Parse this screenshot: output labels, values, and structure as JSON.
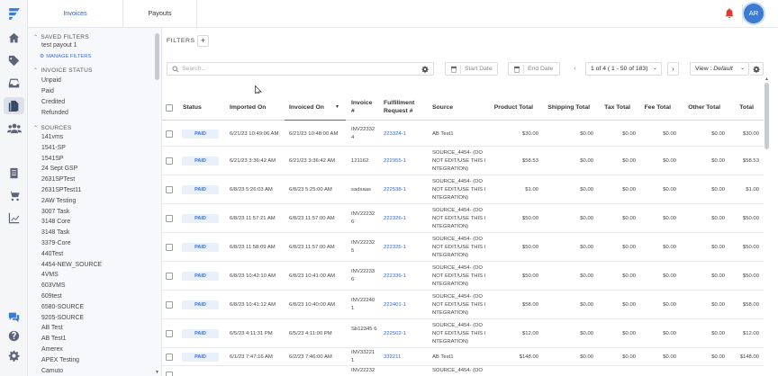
{
  "topbar": {
    "tabs": [
      {
        "label": "Invoices"
      },
      {
        "label": "Payouts"
      }
    ],
    "avatar_initials": "AR"
  },
  "rail": {
    "icons": [
      "logo-icon",
      "home-icon",
      "tag-icon",
      "inbox-icon",
      "invoices-icon",
      "users-icon",
      "report-icon",
      "cart-icon",
      "chart-icon",
      "chat-icon",
      "help-icon",
      "settings-icon"
    ]
  },
  "sidebar": {
    "saved_filters": {
      "heading": "SAVED FILTERS",
      "items": [
        "test payout 1"
      ],
      "manage_link": "MANAGE FILTERS"
    },
    "invoice_status": {
      "heading": "INVOICE STATUS",
      "items": [
        "Unpaid",
        "Paid",
        "Credited",
        "Refunded"
      ]
    },
    "sources": {
      "heading": "SOURCES",
      "items": [
        "141vms",
        "1541-SP",
        "1541SP",
        "24 Sept GSP",
        "2631SPTest",
        "2631SPTest11",
        "2AW Testing",
        "3007 Task",
        "3148 Core",
        "3148 Task",
        "3379-Core",
        "440Test",
        "4454-NEW_SOURCE",
        "4VMS",
        "603VMS",
        "609test",
        "6580-SOURCE",
        "9205-SOURCE",
        "AB Test",
        "AB Test1",
        "Amerex",
        "APEX Testing",
        "Camuto"
      ]
    }
  },
  "toolbar": {
    "filters_label": "FILTERS",
    "add_filter": "+",
    "search_placeholder": "Search...",
    "start_date": "Start Date",
    "end_date": "End Date",
    "prev": "‹",
    "next": "›",
    "page_info": "1 of 4 ( 1 - 50 of 183)",
    "view_label": "View :",
    "view_value": "Default"
  },
  "table": {
    "columns": {
      "status": "Status",
      "imported": "Imported On",
      "invoiced": "Invoiced On",
      "invoice_l1": "Invoice",
      "invoice_l2": "#",
      "fulfill_l1": "Fulfillment",
      "fulfill_l2": "Request #",
      "source": "Source",
      "product": "Product Total",
      "shipping": "Shipping Total",
      "tax": "Tax Total",
      "fee": "Fee Total",
      "other": "Other Total",
      "total": "Total"
    },
    "rows": [
      {
        "status": "PAID",
        "imported": "6/21/23 10:49:06 AM",
        "invoiced": "6/21/23 10:48:00 AM",
        "invoice": "INV22332 4",
        "fulfill": "223324-1",
        "source": "AB Test1",
        "product": "$30.00",
        "shipping": "$0.00",
        "tax": "$0.00",
        "fee": "$0.00",
        "other": "$0.00",
        "total": "$30.00"
      },
      {
        "status": "PAID",
        "imported": "6/21/23 3:36:42 AM",
        "invoiced": "6/21/23 3:36:42 AM",
        "invoice": "121162",
        "fulfill": "222955-1",
        "source": "SOURCE_4454- (DO NOT EDIT/USE THIS I NTEGRATION)",
        "product": "$58.53",
        "shipping": "$0.00",
        "tax": "$0.00",
        "fee": "$0.00",
        "other": "$0.00",
        "total": "$58.53"
      },
      {
        "status": "PAID",
        "imported": "6/8/23 5:26:03 AM",
        "invoiced": "6/8/23 5:25:00 AM",
        "invoice": "sadsaas",
        "fulfill": "222538-1",
        "source": "SOURCE_4454- (DO NOT EDIT/USE THIS I NTEGRATION)",
        "product": "$1.00",
        "shipping": "$0.00",
        "tax": "$0.00",
        "fee": "$0.00",
        "other": "$0.00",
        "total": "$1.00"
      },
      {
        "status": "PAID",
        "imported": "6/8/23 11:57:21 AM",
        "invoiced": "6/8/23 11:57:00 AM",
        "invoice": "INV22232 6",
        "fulfill": "222326-1",
        "source": "SOURCE_4454- (DO NOT EDIT/USE THIS I NTEGRATION)",
        "product": "$50.00",
        "shipping": "$0.00",
        "tax": "$0.00",
        "fee": "$0.00",
        "other": "$0.00",
        "total": "$50.00"
      },
      {
        "status": "PAID",
        "imported": "6/8/23 11:58:09 AM",
        "invoiced": "6/8/23 11:57:00 AM",
        "invoice": "INV22232 5",
        "fulfill": "222325-1",
        "source": "SOURCE_4454- (DO NOT EDIT/USE THIS I NTEGRATION)",
        "product": "$50.00",
        "shipping": "$0.00",
        "tax": "$0.00",
        "fee": "$0.00",
        "other": "$0.00",
        "total": "$50.00"
      },
      {
        "status": "PAID",
        "imported": "6/8/23 10:42:10 AM",
        "invoiced": "6/8/23 10:41:00 AM",
        "invoice": "INV22233 6",
        "fulfill": "222336-1",
        "source": "SOURCE_4454- (DO NOT EDIT/USE THIS I NTEGRATION)",
        "product": "$50.00",
        "shipping": "$0.00",
        "tax": "$0.00",
        "fee": "$0.00",
        "other": "$0.00",
        "total": "$50.00"
      },
      {
        "status": "PAID",
        "imported": "6/8/23 10:41:12 AM",
        "invoiced": "6/8/23 10:40:00 AM",
        "invoice": "INV22240 1",
        "fulfill": "222401-1",
        "source": "SOURCE_4454- (DO NOT EDIT/USE THIS I NTEGRATION)",
        "product": "$58.00",
        "shipping": "$0.00",
        "tax": "$0.00",
        "fee": "$0.00",
        "other": "$0.00",
        "total": "$58.00"
      },
      {
        "status": "PAID",
        "imported": "6/5/23 4:11:31 PM",
        "invoiced": "6/5/23 4:11:00 PM",
        "invoice": "Sb12345 6",
        "fulfill": "222502-1",
        "source": "SOURCE_4454- (DO NOT EDIT/USE THIS I NTEGRATION)",
        "product": "$12.00",
        "shipping": "$0.00",
        "tax": "$0.00",
        "fee": "$0.00",
        "other": "$0.00",
        "total": "$12.00"
      },
      {
        "status": "PAID",
        "imported": "6/1/23 7:47:16 AM",
        "invoiced": "6/2/23 7:46:00 AM",
        "invoice": "INV33221 1",
        "fulfill": "332211",
        "source": "AB Test1",
        "product": "$148.00",
        "shipping": "$0.00",
        "tax": "$0.00",
        "fee": "$0.00",
        "other": "$0.00",
        "total": "$148.00"
      },
      {
        "status": "",
        "imported": "",
        "invoiced": "",
        "invoice": "INV22232",
        "fulfill": "",
        "source": "SOURCE_4454- (DO",
        "product": "",
        "shipping": "",
        "tax": "",
        "fee": "",
        "other": "",
        "total": ""
      }
    ]
  },
  "colors": {
    "accent": "#2f5fd0",
    "bell": "#e23a2e",
    "avatar": "#3b7bd4",
    "badge_bg": "#e8f0fb"
  }
}
